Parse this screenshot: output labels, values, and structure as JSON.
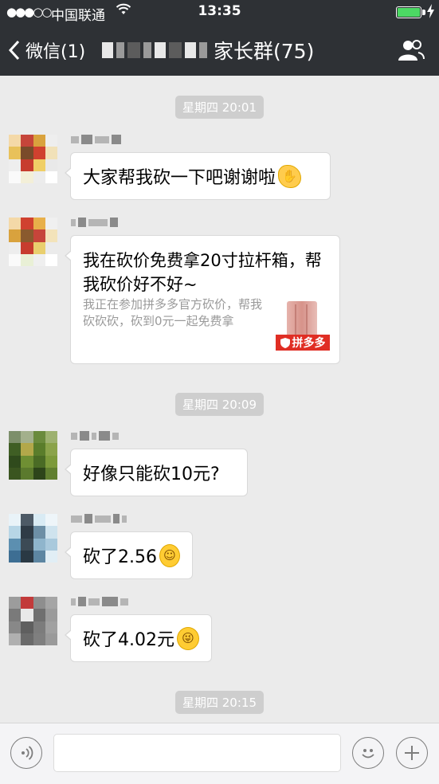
{
  "status_bar": {
    "signal": "●●●○○",
    "carrier": "中国联通",
    "time": "13:35"
  },
  "nav": {
    "back_label": "微信(1)",
    "title": "家长群(75)"
  },
  "chat": {
    "time_separators": [
      "星期四 20:01",
      "星期四 20:09",
      "星期四 20:15"
    ],
    "messages": [
      {
        "type": "text",
        "text": "大家帮我砍一下吧谢谢啦",
        "emoji": "handshake"
      },
      {
        "type": "link_card",
        "title": "我在砍价免费拿20寸拉杆箱，帮我砍价好不好~",
        "description": "我正在参加拼多多官方砍价，帮我砍砍砍，砍到0元一起免费拿",
        "brand": "拼多多"
      },
      {
        "type": "text",
        "text": "好像只能砍10元?"
      },
      {
        "type": "text",
        "text": "砍了2.56",
        "emoji": "crying-laughing"
      },
      {
        "type": "text",
        "text": "砍了4.02元",
        "emoji": "winking-tongue"
      }
    ]
  },
  "colors": {
    "nav_bg": "#2e3135",
    "chat_bg": "#ebebeb",
    "time_badge_bg": "#cecece",
    "battery": "#4cd964",
    "brand_red": "#e02e24"
  },
  "icons": [
    "back-chevron-icon",
    "group-members-icon",
    "voice-icon",
    "emoji-icon",
    "plus-icon",
    "wifi-icon",
    "battery-icon",
    "charging-icon"
  ]
}
